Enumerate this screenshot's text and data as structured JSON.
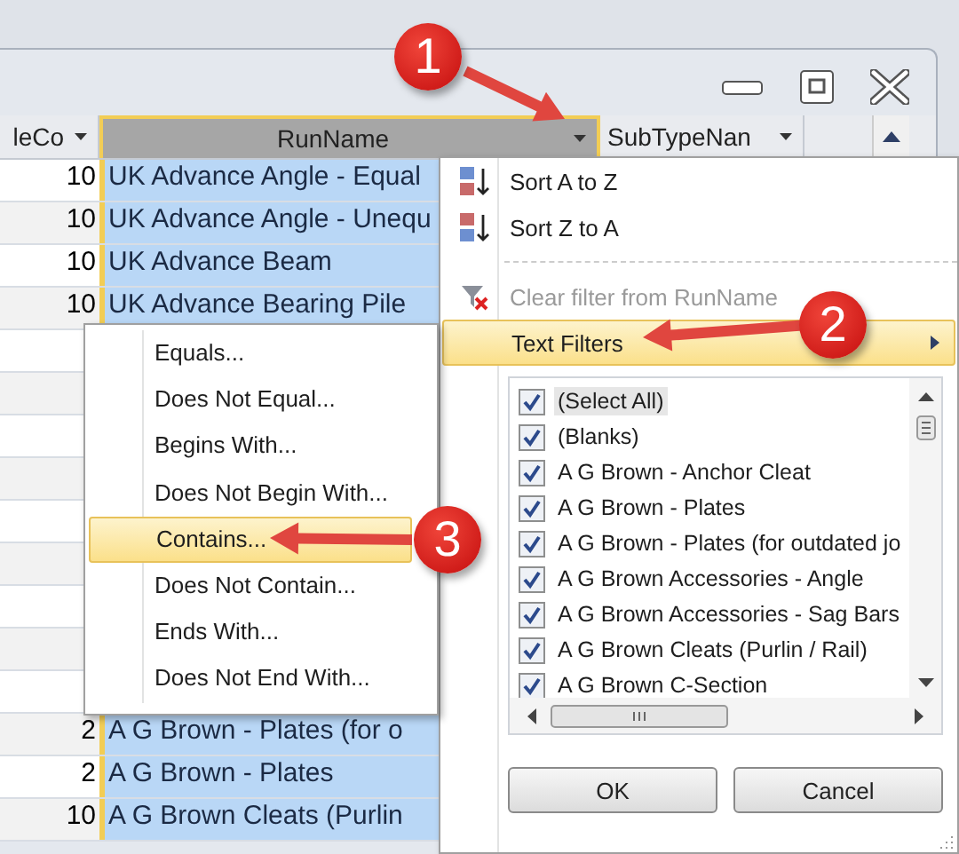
{
  "columns": [
    {
      "label": "leCo",
      "sorted": false
    },
    {
      "label": "RunName",
      "sorted": true
    },
    {
      "label": "SubTypeNan",
      "sorted": false
    }
  ],
  "rows": [
    {
      "count": "10",
      "run_name": "UK Advance Angle - Equal"
    },
    {
      "count": "10",
      "run_name": "UK Advance Angle - Unequ"
    },
    {
      "count": "10",
      "run_name": "UK Advance Beam"
    },
    {
      "count": "10",
      "run_name": "UK Advance Bearing Pile"
    },
    {},
    {},
    {},
    {},
    {},
    {},
    {},
    {},
    {},
    {
      "count": "2",
      "run_name": "A G Brown - Plates (for o"
    },
    {
      "count": "2",
      "run_name": "A G Brown - Plates"
    },
    {
      "count": "10",
      "run_name": "A G Brown Cleats (Purlin"
    }
  ],
  "filter_menu": {
    "items": [
      {
        "kind": "sort_ascending",
        "label": "Sort A to Z",
        "disabled": false,
        "selected": false
      },
      {
        "kind": "sort_descending",
        "label": "Sort Z to A",
        "disabled": false,
        "selected": false
      },
      {
        "kind": "separator"
      },
      {
        "kind": "clear",
        "label": "Clear filter from RunName",
        "disabled": true,
        "selected": false
      },
      {
        "kind": "submenu",
        "label": "Text Filters",
        "disabled": false,
        "selected": true
      }
    ],
    "values": [
      {
        "label": "(Select All)",
        "checked": true,
        "selected": true
      },
      {
        "label": "(Blanks)",
        "checked": true,
        "selected": false
      },
      {
        "label": "A G Brown - Anchor Cleat",
        "checked": true,
        "selected": false
      },
      {
        "label": "A G Brown - Plates",
        "checked": true,
        "selected": false
      },
      {
        "label": "A G Brown - Plates (for outdated jo",
        "checked": true,
        "selected": false
      },
      {
        "label": "A G Brown Accessories - Angle",
        "checked": true,
        "selected": false
      },
      {
        "label": "A G Brown Accessories - Sag Bars",
        "checked": true,
        "selected": false
      },
      {
        "label": "A G Brown Cleats (Purlin / Rail)",
        "checked": true,
        "selected": false
      },
      {
        "label": "A G Brown C-Section",
        "checked": true,
        "selected": false
      }
    ],
    "buttons": [
      "OK",
      "Cancel"
    ]
  },
  "text_filters": [
    {
      "label": "Equals...",
      "selected": false
    },
    {
      "label": "Does Not Equal...",
      "selected": false
    },
    {
      "label": "Begins With...",
      "selected": false
    },
    {
      "label": "Does Not Begin With...",
      "selected": false
    },
    {
      "label": "Contains...",
      "selected": true
    },
    {
      "label": "Does Not Contain...",
      "selected": false
    },
    {
      "label": "Ends With...",
      "selected": false
    },
    {
      "label": "Does Not End With...",
      "selected": false
    }
  ],
  "callouts": [
    {
      "number": "1"
    },
    {
      "number": "2"
    },
    {
      "number": "3"
    }
  ]
}
